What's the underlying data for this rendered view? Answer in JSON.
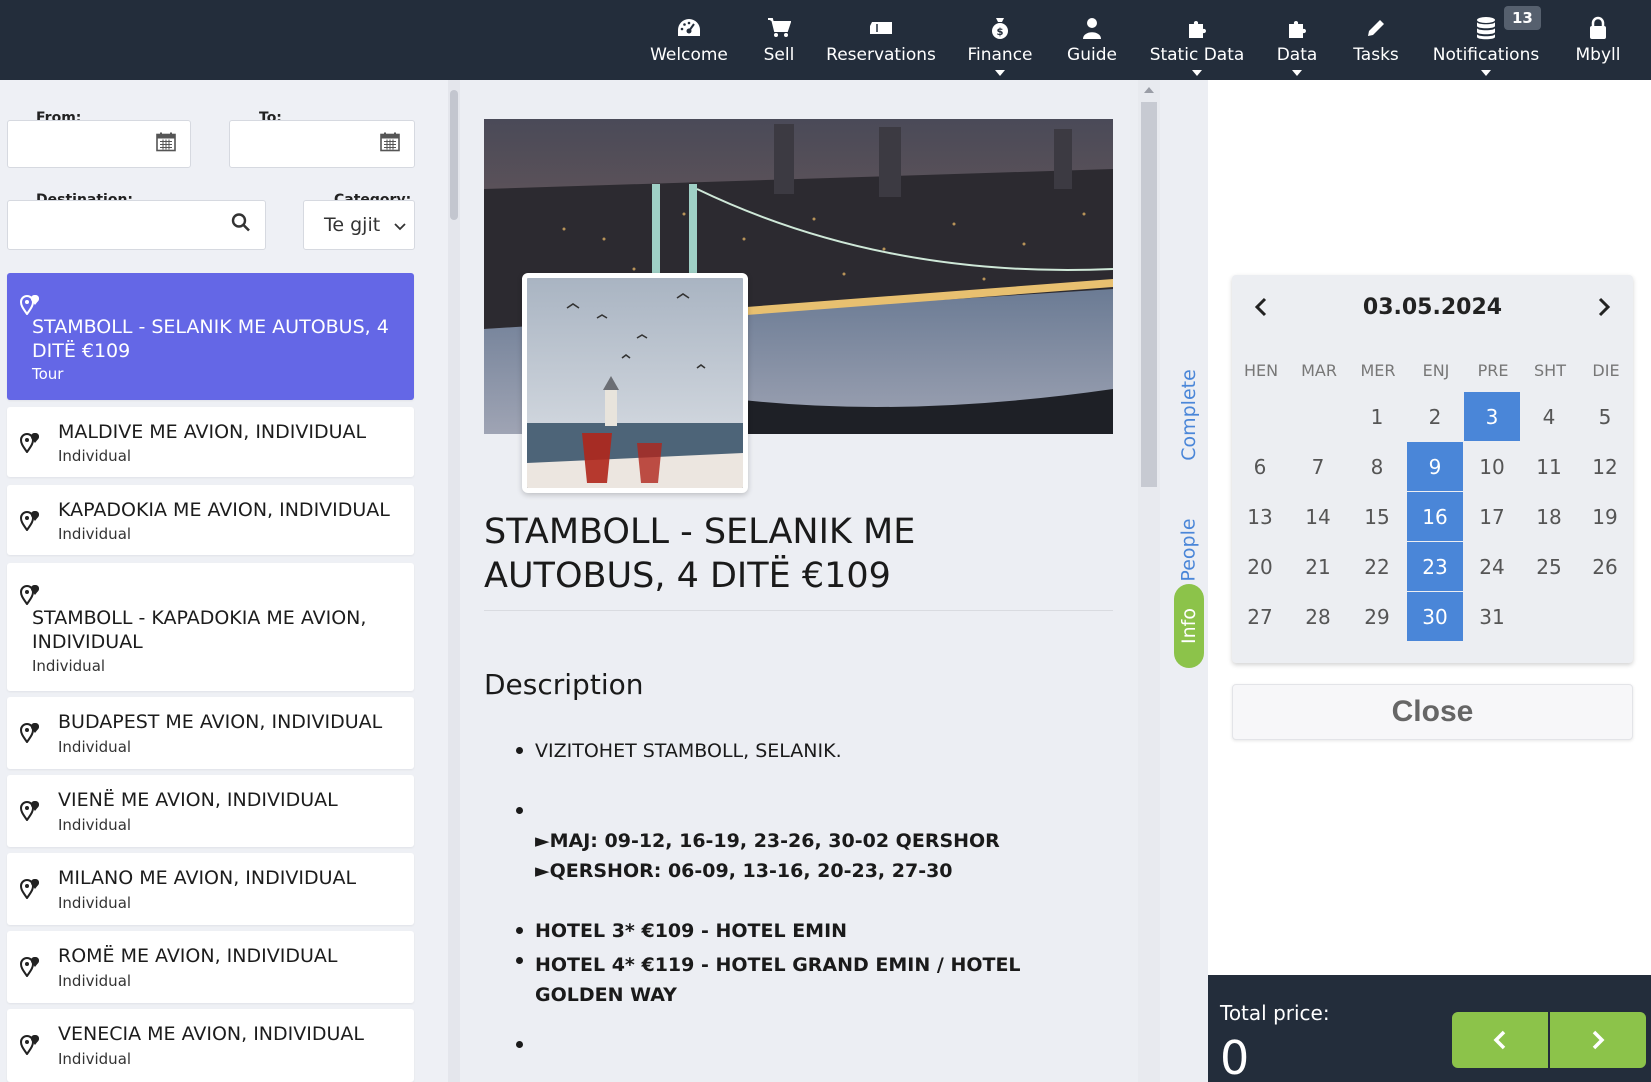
{
  "nav": {
    "items": [
      {
        "label": "Welcome",
        "icon": "dashboard-icon"
      },
      {
        "label": "Sell",
        "icon": "cart-icon"
      },
      {
        "label": "Reservations",
        "icon": "ticket-icon"
      },
      {
        "label": "Finance",
        "icon": "money-bag-icon"
      },
      {
        "label": "Guide",
        "icon": "user-icon"
      },
      {
        "label": "Static Data",
        "icon": "puzzle-icon"
      },
      {
        "label": "Data",
        "icon": "puzzle-icon"
      },
      {
        "label": "Tasks",
        "icon": "pencil-icon"
      },
      {
        "label": "Notifications",
        "icon": "database-icon"
      },
      {
        "label": "Mbyll",
        "icon": "lock-icon"
      }
    ],
    "notifications_count": "13"
  },
  "filters": {
    "from_label": "From:",
    "to_label": "To:",
    "destination_label": "Destination:",
    "category_label": "Category:",
    "category_value": "Te gjit"
  },
  "tours": [
    {
      "title": "STAMBOLL - SELANIK ME AUTOBUS, 4 DITË €109",
      "type": "Tour"
    },
    {
      "title": "MALDIVE ME AVION, INDIVIDUAL",
      "type": "Individual"
    },
    {
      "title": "KAPADOKIA ME AVION, INDIVIDUAL",
      "type": "Individual"
    },
    {
      "title": "STAMBOLL - KAPADOKIA ME AVION, INDIVIDUAL",
      "type": "Individual"
    },
    {
      "title": "BUDAPEST ME AVION, INDIVIDUAL",
      "type": "Individual"
    },
    {
      "title": "VIENË ME AVION, INDIVIDUAL",
      "type": "Individual"
    },
    {
      "title": "MILANO ME AVION, INDIVIDUAL",
      "type": "Individual"
    },
    {
      "title": "ROMË ME AVION, INDIVIDUAL",
      "type": "Individual"
    },
    {
      "title": "VENECIA ME AVION, INDIVIDUAL",
      "type": "Individual"
    }
  ],
  "detail": {
    "title": "STAMBOLL - SELANIK ME AUTOBUS, 4 DITË €109",
    "description_heading": "Description",
    "bullet1": "VIZITOHET STAMBOLL, SELANIK.",
    "dates1": "►MAJ: 09-12, 16-19, 23-26, 30-02 QERSHOR",
    "dates2": "►QERSHOR: 06-09, 13-16, 20-23, 27-30",
    "hotel1": "HOTEL 3* €109 - HOTEL EMIN",
    "hotel2": "HOTEL 4* €119 - HOTEL GRAND EMIN / HOTEL GOLDEN WAY"
  },
  "side_tabs": {
    "complete": "Complete",
    "people": "People",
    "info": "Info"
  },
  "calendar": {
    "month_label": "03.05.2024",
    "weekdays": [
      "HEN",
      "MAR",
      "MER",
      "ENJ",
      "PRE",
      "SHT",
      "DIE"
    ],
    "first_weekday_index": 2,
    "days_in_month": 31,
    "selected_day": 3,
    "available_days": [
      9,
      16,
      23,
      30
    ],
    "close_label": "Close"
  },
  "footer": {
    "total_label": "Total price:",
    "total_value": "0"
  },
  "colors": {
    "nav_bg": "#232d3b",
    "accent": "#6467e6",
    "calendar_hl": "#4a86d8",
    "green": "#8cc34a"
  }
}
